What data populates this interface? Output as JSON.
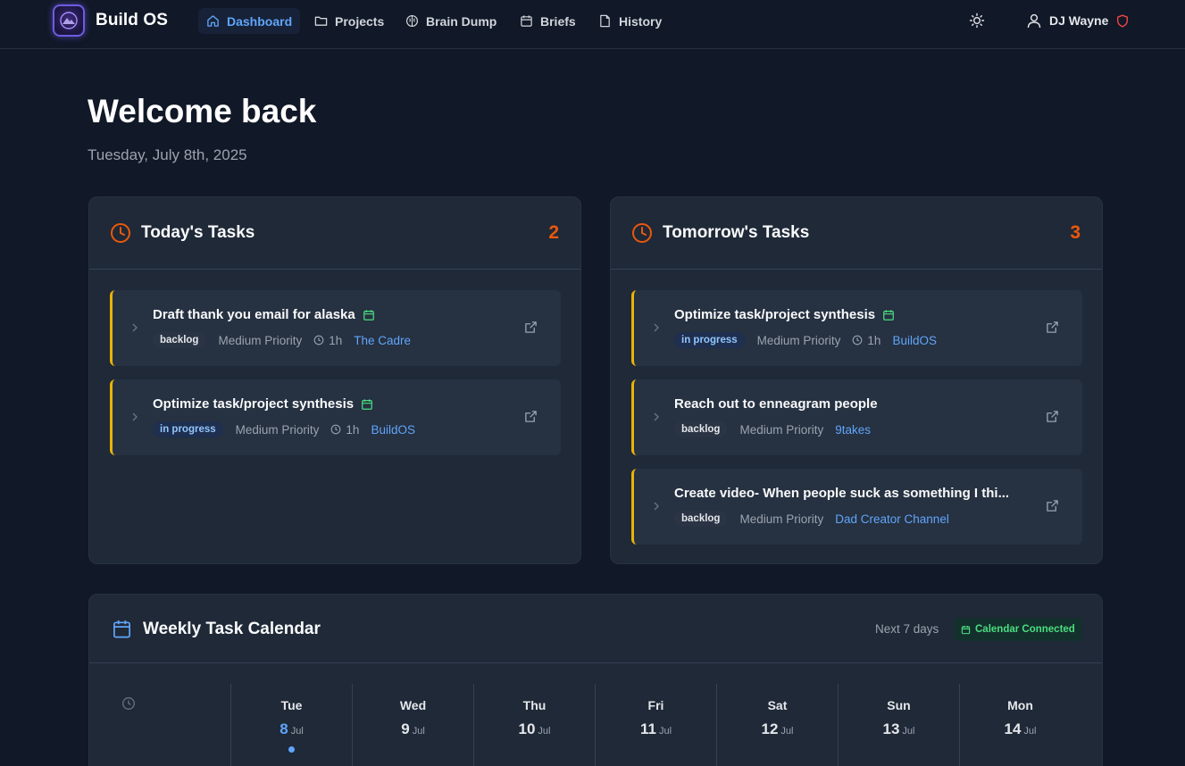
{
  "app": {
    "brand": "Build OS"
  },
  "nav": {
    "items": [
      {
        "label": "Dashboard",
        "icon": "home-icon",
        "active": true
      },
      {
        "label": "Projects",
        "icon": "folder-icon",
        "active": false
      },
      {
        "label": "Brain Dump",
        "icon": "brain-icon",
        "active": false
      },
      {
        "label": "Briefs",
        "icon": "calendar-icon",
        "active": false
      },
      {
        "label": "History",
        "icon": "file-icon",
        "active": false
      }
    ],
    "theme_icon": "sun-icon",
    "user_name": "DJ Wayne",
    "user_icon": "user-icon",
    "admin_icon": "shield-icon"
  },
  "header": {
    "title": "Welcome back",
    "date": "Tuesday, July 8th, 2025"
  },
  "today": {
    "title": "Today's Tasks",
    "count": "2",
    "tasks": [
      {
        "title": "Draft thank you email for alaska",
        "status": "backlog",
        "priority": "Medium Priority",
        "duration": "1h",
        "project": "The Cadre",
        "scheduled": true
      },
      {
        "title": "Optimize task/project synthesis",
        "status": "in progress",
        "priority": "Medium Priority",
        "duration": "1h",
        "project": "BuildOS",
        "scheduled": true
      }
    ]
  },
  "tomorrow": {
    "title": "Tomorrow's Tasks",
    "count": "3",
    "tasks": [
      {
        "title": "Optimize task/project synthesis",
        "status": "in progress",
        "priority": "Medium Priority",
        "duration": "1h",
        "project": "BuildOS",
        "scheduled": true
      },
      {
        "title": "Reach out to enneagram people",
        "status": "backlog",
        "priority": "Medium Priority",
        "duration": "",
        "project": "9takes",
        "scheduled": false
      },
      {
        "title": "Create video- When people suck as something I thi...",
        "status": "backlog",
        "priority": "Medium Priority",
        "duration": "",
        "project": "Dad Creator Channel",
        "scheduled": false
      }
    ]
  },
  "calendar": {
    "title": "Weekly Task Calendar",
    "range_label": "Next 7 days",
    "connected_label": "Calendar Connected",
    "days": [
      {
        "name": "Tue",
        "num": "8",
        "month": "Jul",
        "today": true
      },
      {
        "name": "Wed",
        "num": "9",
        "month": "Jul",
        "today": false
      },
      {
        "name": "Thu",
        "num": "10",
        "month": "Jul",
        "today": false
      },
      {
        "name": "Fri",
        "num": "11",
        "month": "Jul",
        "today": false
      },
      {
        "name": "Sat",
        "num": "12",
        "month": "Jul",
        "today": false
      },
      {
        "name": "Sun",
        "num": "13",
        "month": "Jul",
        "today": false
      },
      {
        "name": "Mon",
        "num": "14",
        "month": "Jul",
        "today": false
      }
    ]
  },
  "colors": {
    "background": "#111827",
    "card": "#1f2937",
    "accent": "#60a5fa",
    "count_orange": "#ea580c",
    "task_border": "#eab308",
    "connected_green": "#4ade80"
  }
}
